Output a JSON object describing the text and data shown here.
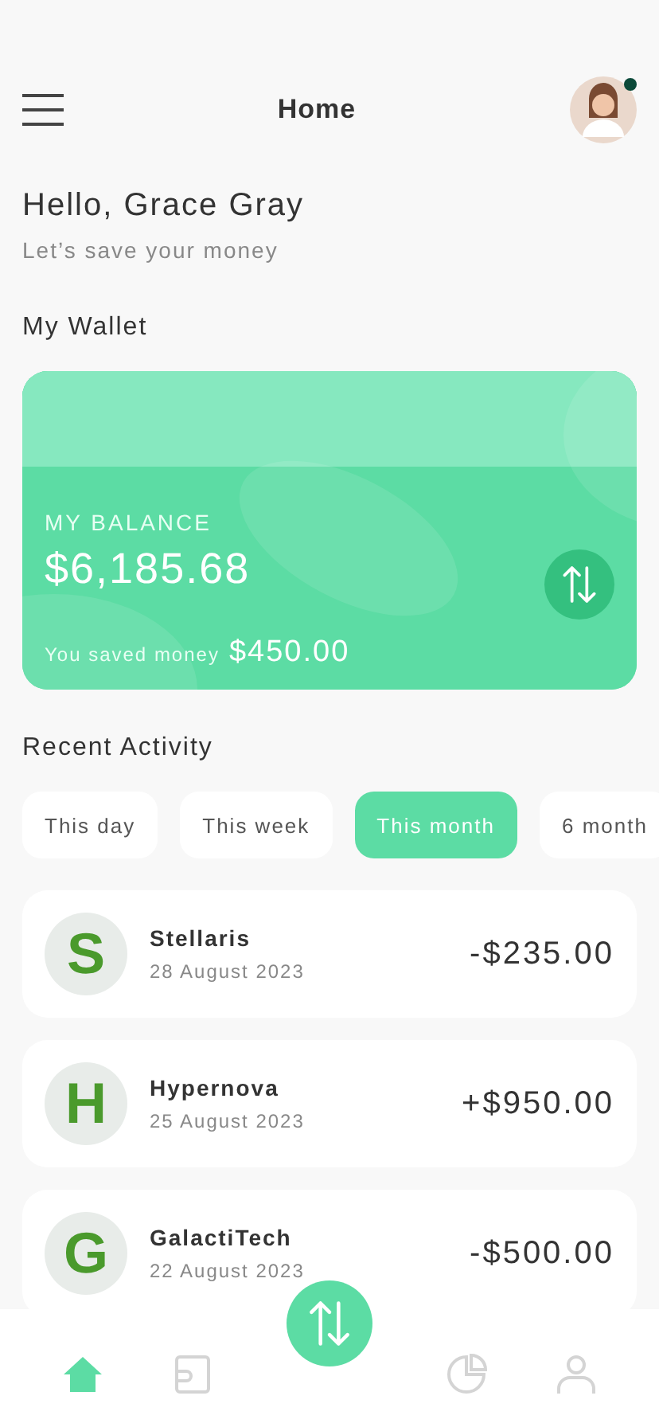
{
  "header": {
    "title": "Home",
    "avatar": {
      "online": true
    }
  },
  "greeting": {
    "title": "Hello, Grace Gray",
    "subtitle": "Let’s save your money"
  },
  "wallet": {
    "heading": "My Wallet",
    "label": "MY BALANCE",
    "balance": "$6,185.68",
    "saved_label": "You saved money",
    "saved_amount": "$450.00"
  },
  "activity": {
    "heading": "Recent Activity",
    "filters": [
      {
        "label": "This day",
        "selected": false
      },
      {
        "label": "This week",
        "selected": false
      },
      {
        "label": "This month",
        "selected": true
      },
      {
        "label": "6 month",
        "selected": false
      }
    ],
    "transactions": [
      {
        "logo": "S",
        "name": "Stellaris",
        "date": "28 August 2023",
        "amount": "-$235.00"
      },
      {
        "logo": "H",
        "name": "Hypernova",
        "date": "25 August 2023",
        "amount": "+$950.00"
      },
      {
        "logo": "G",
        "name": "GalactiTech",
        "date": "22 August 2023",
        "amount": "-$500.00"
      }
    ]
  },
  "bottom_nav": [
    {
      "kind": "home",
      "selected": true
    },
    {
      "kind": "wallet",
      "selected": false
    },
    {
      "kind": "transfer",
      "selected": false
    },
    {
      "kind": "chart",
      "selected": false
    },
    {
      "kind": "profile",
      "selected": false
    }
  ]
}
